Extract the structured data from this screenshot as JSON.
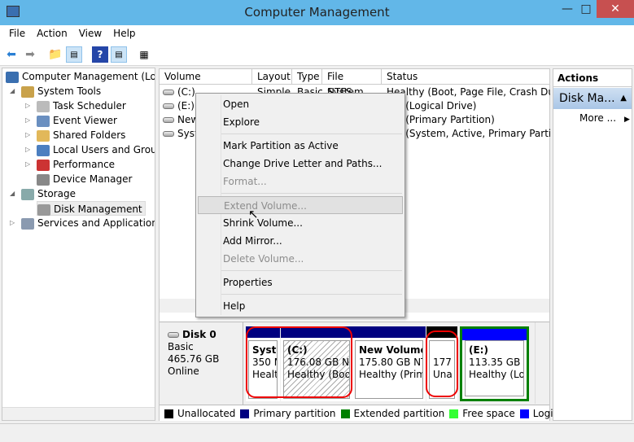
{
  "window": {
    "title": "Computer Management",
    "icon": "computer-management-icon"
  },
  "menubar": [
    "File",
    "Action",
    "View",
    "Help"
  ],
  "tree": {
    "root": "Computer Management (Local",
    "items": [
      {
        "label": "System Tools",
        "level": 1,
        "expanded": true,
        "icon": "tools-icon"
      },
      {
        "label": "Task Scheduler",
        "level": 2,
        "expandable": true,
        "icon": "clock-icon"
      },
      {
        "label": "Event Viewer",
        "level": 2,
        "expandable": true,
        "icon": "event-viewer-icon"
      },
      {
        "label": "Shared Folders",
        "level": 2,
        "expandable": true,
        "icon": "shared-folder-icon"
      },
      {
        "label": "Local Users and Groups",
        "level": 2,
        "expandable": true,
        "icon": "users-icon"
      },
      {
        "label": "Performance",
        "level": 2,
        "expandable": true,
        "icon": "performance-icon"
      },
      {
        "label": "Device Manager",
        "level": 2,
        "expandable": false,
        "icon": "device-manager-icon"
      },
      {
        "label": "Storage",
        "level": 1,
        "expanded": true,
        "icon": "storage-icon"
      },
      {
        "label": "Disk Management",
        "level": 2,
        "expandable": false,
        "selected": true,
        "icon": "disk-icon"
      },
      {
        "label": "Services and Applications",
        "level": 1,
        "expandable": true,
        "icon": "services-icon"
      }
    ]
  },
  "volumes": {
    "columns": [
      "Volume",
      "Layout",
      "Type",
      "File System",
      "Status"
    ],
    "rows": [
      {
        "volume": "(C:)",
        "layout": "Simple",
        "type": "Basic",
        "fs": "NTFS",
        "status": "Healthy (Boot, Page File, Crash Dump,"
      },
      {
        "volume": "(E:)",
        "layout": "",
        "type": "",
        "fs": "",
        "status": "thy (Logical Drive)"
      },
      {
        "volume": "New",
        "layout": "",
        "type": "",
        "fs": "",
        "status": "thy (Primary Partition)"
      },
      {
        "volume": "Syste",
        "layout": "",
        "type": "",
        "fs": "",
        "status": "thy (System, Active, Primary Parti"
      }
    ]
  },
  "disk": {
    "name": "Disk 0",
    "type": "Basic",
    "size": "465.76 GB",
    "state": "Online",
    "partitions": [
      {
        "name": "Syste",
        "size": "350 M",
        "status": "Healt",
        "bar_color": "#000080"
      },
      {
        "name": "(C:)",
        "size": "176.08 GB NTF",
        "status": "Healthy (Boot,",
        "bar_color": "#000080",
        "selected": true
      },
      {
        "name": "New Volume",
        "size": "175.80 GB NTF",
        "status": "Healthy (Prim",
        "bar_color": "#000080"
      },
      {
        "name": "",
        "size": "177 I",
        "status": "Una",
        "bar_color": "#000000"
      },
      {
        "name": "(E:)",
        "size": "113.35 GB NT",
        "status": "Healthy (Log",
        "bar_color": "#0000ff",
        "extended_border": "#008000"
      }
    ]
  },
  "legend": [
    {
      "label": "Unallocated",
      "color": "#000000"
    },
    {
      "label": "Primary partition",
      "color": "#000080"
    },
    {
      "label": "Extended partition",
      "color": "#008000"
    },
    {
      "label": "Free space",
      "color": "#33ff33"
    },
    {
      "label": "Logical drive",
      "color": "#0000ff"
    }
  ],
  "actions": {
    "header": "Actions",
    "section": "Disk Ma...",
    "more": "More ..."
  },
  "context_menu": [
    {
      "label": "Open",
      "enabled": true
    },
    {
      "label": "Explore",
      "enabled": true
    },
    {
      "sep": true
    },
    {
      "label": "Mark Partition as Active",
      "enabled": true
    },
    {
      "label": "Change Drive Letter and Paths...",
      "enabled": true
    },
    {
      "label": "Format...",
      "enabled": false
    },
    {
      "sep": true
    },
    {
      "label": "Extend Volume...",
      "enabled": false,
      "hovered": true
    },
    {
      "label": "Shrink Volume...",
      "enabled": true
    },
    {
      "label": "Add Mirror...",
      "enabled": true
    },
    {
      "label": "Delete Volume...",
      "enabled": false
    },
    {
      "sep": true
    },
    {
      "label": "Properties",
      "enabled": true
    },
    {
      "sep": true
    },
    {
      "label": "Help",
      "enabled": true
    }
  ],
  "colors": {
    "titlebar": "#62b7e8",
    "close": "#c75050",
    "highlight_ring": "#e00000"
  }
}
